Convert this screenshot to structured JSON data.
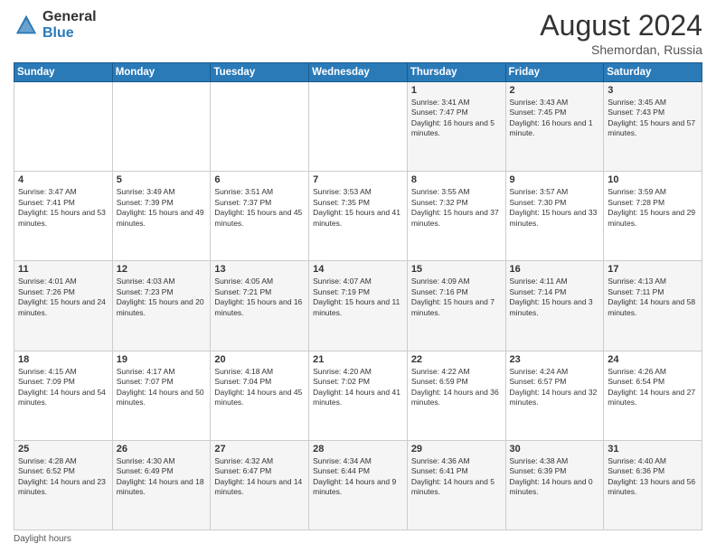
{
  "header": {
    "logo_general": "General",
    "logo_blue": "Blue",
    "month_title": "August 2024",
    "location": "Shemordan, Russia"
  },
  "days_of_week": [
    "Sunday",
    "Monday",
    "Tuesday",
    "Wednesday",
    "Thursday",
    "Friday",
    "Saturday"
  ],
  "footer": {
    "daylight_label": "Daylight hours"
  },
  "weeks": [
    [
      {
        "day": "",
        "sunrise": "",
        "sunset": "",
        "daylight": ""
      },
      {
        "day": "",
        "sunrise": "",
        "sunset": "",
        "daylight": ""
      },
      {
        "day": "",
        "sunrise": "",
        "sunset": "",
        "daylight": ""
      },
      {
        "day": "",
        "sunrise": "",
        "sunset": "",
        "daylight": ""
      },
      {
        "day": "1",
        "sunrise": "Sunrise: 3:41 AM",
        "sunset": "Sunset: 7:47 PM",
        "daylight": "Daylight: 16 hours and 5 minutes."
      },
      {
        "day": "2",
        "sunrise": "Sunrise: 3:43 AM",
        "sunset": "Sunset: 7:45 PM",
        "daylight": "Daylight: 16 hours and 1 minute."
      },
      {
        "day": "3",
        "sunrise": "Sunrise: 3:45 AM",
        "sunset": "Sunset: 7:43 PM",
        "daylight": "Daylight: 15 hours and 57 minutes."
      }
    ],
    [
      {
        "day": "4",
        "sunrise": "Sunrise: 3:47 AM",
        "sunset": "Sunset: 7:41 PM",
        "daylight": "Daylight: 15 hours and 53 minutes."
      },
      {
        "day": "5",
        "sunrise": "Sunrise: 3:49 AM",
        "sunset": "Sunset: 7:39 PM",
        "daylight": "Daylight: 15 hours and 49 minutes."
      },
      {
        "day": "6",
        "sunrise": "Sunrise: 3:51 AM",
        "sunset": "Sunset: 7:37 PM",
        "daylight": "Daylight: 15 hours and 45 minutes."
      },
      {
        "day": "7",
        "sunrise": "Sunrise: 3:53 AM",
        "sunset": "Sunset: 7:35 PM",
        "daylight": "Daylight: 15 hours and 41 minutes."
      },
      {
        "day": "8",
        "sunrise": "Sunrise: 3:55 AM",
        "sunset": "Sunset: 7:32 PM",
        "daylight": "Daylight: 15 hours and 37 minutes."
      },
      {
        "day": "9",
        "sunrise": "Sunrise: 3:57 AM",
        "sunset": "Sunset: 7:30 PM",
        "daylight": "Daylight: 15 hours and 33 minutes."
      },
      {
        "day": "10",
        "sunrise": "Sunrise: 3:59 AM",
        "sunset": "Sunset: 7:28 PM",
        "daylight": "Daylight: 15 hours and 29 minutes."
      }
    ],
    [
      {
        "day": "11",
        "sunrise": "Sunrise: 4:01 AM",
        "sunset": "Sunset: 7:26 PM",
        "daylight": "Daylight: 15 hours and 24 minutes."
      },
      {
        "day": "12",
        "sunrise": "Sunrise: 4:03 AM",
        "sunset": "Sunset: 7:23 PM",
        "daylight": "Daylight: 15 hours and 20 minutes."
      },
      {
        "day": "13",
        "sunrise": "Sunrise: 4:05 AM",
        "sunset": "Sunset: 7:21 PM",
        "daylight": "Daylight: 15 hours and 16 minutes."
      },
      {
        "day": "14",
        "sunrise": "Sunrise: 4:07 AM",
        "sunset": "Sunset: 7:19 PM",
        "daylight": "Daylight: 15 hours and 11 minutes."
      },
      {
        "day": "15",
        "sunrise": "Sunrise: 4:09 AM",
        "sunset": "Sunset: 7:16 PM",
        "daylight": "Daylight: 15 hours and 7 minutes."
      },
      {
        "day": "16",
        "sunrise": "Sunrise: 4:11 AM",
        "sunset": "Sunset: 7:14 PM",
        "daylight": "Daylight: 15 hours and 3 minutes."
      },
      {
        "day": "17",
        "sunrise": "Sunrise: 4:13 AM",
        "sunset": "Sunset: 7:11 PM",
        "daylight": "Daylight: 14 hours and 58 minutes."
      }
    ],
    [
      {
        "day": "18",
        "sunrise": "Sunrise: 4:15 AM",
        "sunset": "Sunset: 7:09 PM",
        "daylight": "Daylight: 14 hours and 54 minutes."
      },
      {
        "day": "19",
        "sunrise": "Sunrise: 4:17 AM",
        "sunset": "Sunset: 7:07 PM",
        "daylight": "Daylight: 14 hours and 50 minutes."
      },
      {
        "day": "20",
        "sunrise": "Sunrise: 4:18 AM",
        "sunset": "Sunset: 7:04 PM",
        "daylight": "Daylight: 14 hours and 45 minutes."
      },
      {
        "day": "21",
        "sunrise": "Sunrise: 4:20 AM",
        "sunset": "Sunset: 7:02 PM",
        "daylight": "Daylight: 14 hours and 41 minutes."
      },
      {
        "day": "22",
        "sunrise": "Sunrise: 4:22 AM",
        "sunset": "Sunset: 6:59 PM",
        "daylight": "Daylight: 14 hours and 36 minutes."
      },
      {
        "day": "23",
        "sunrise": "Sunrise: 4:24 AM",
        "sunset": "Sunset: 6:57 PM",
        "daylight": "Daylight: 14 hours and 32 minutes."
      },
      {
        "day": "24",
        "sunrise": "Sunrise: 4:26 AM",
        "sunset": "Sunset: 6:54 PM",
        "daylight": "Daylight: 14 hours and 27 minutes."
      }
    ],
    [
      {
        "day": "25",
        "sunrise": "Sunrise: 4:28 AM",
        "sunset": "Sunset: 6:52 PM",
        "daylight": "Daylight: 14 hours and 23 minutes."
      },
      {
        "day": "26",
        "sunrise": "Sunrise: 4:30 AM",
        "sunset": "Sunset: 6:49 PM",
        "daylight": "Daylight: 14 hours and 18 minutes."
      },
      {
        "day": "27",
        "sunrise": "Sunrise: 4:32 AM",
        "sunset": "Sunset: 6:47 PM",
        "daylight": "Daylight: 14 hours and 14 minutes."
      },
      {
        "day": "28",
        "sunrise": "Sunrise: 4:34 AM",
        "sunset": "Sunset: 6:44 PM",
        "daylight": "Daylight: 14 hours and 9 minutes."
      },
      {
        "day": "29",
        "sunrise": "Sunrise: 4:36 AM",
        "sunset": "Sunset: 6:41 PM",
        "daylight": "Daylight: 14 hours and 5 minutes."
      },
      {
        "day": "30",
        "sunrise": "Sunrise: 4:38 AM",
        "sunset": "Sunset: 6:39 PM",
        "daylight": "Daylight: 14 hours and 0 minutes."
      },
      {
        "day": "31",
        "sunrise": "Sunrise: 4:40 AM",
        "sunset": "Sunset: 6:36 PM",
        "daylight": "Daylight: 13 hours and 56 minutes."
      }
    ]
  ]
}
